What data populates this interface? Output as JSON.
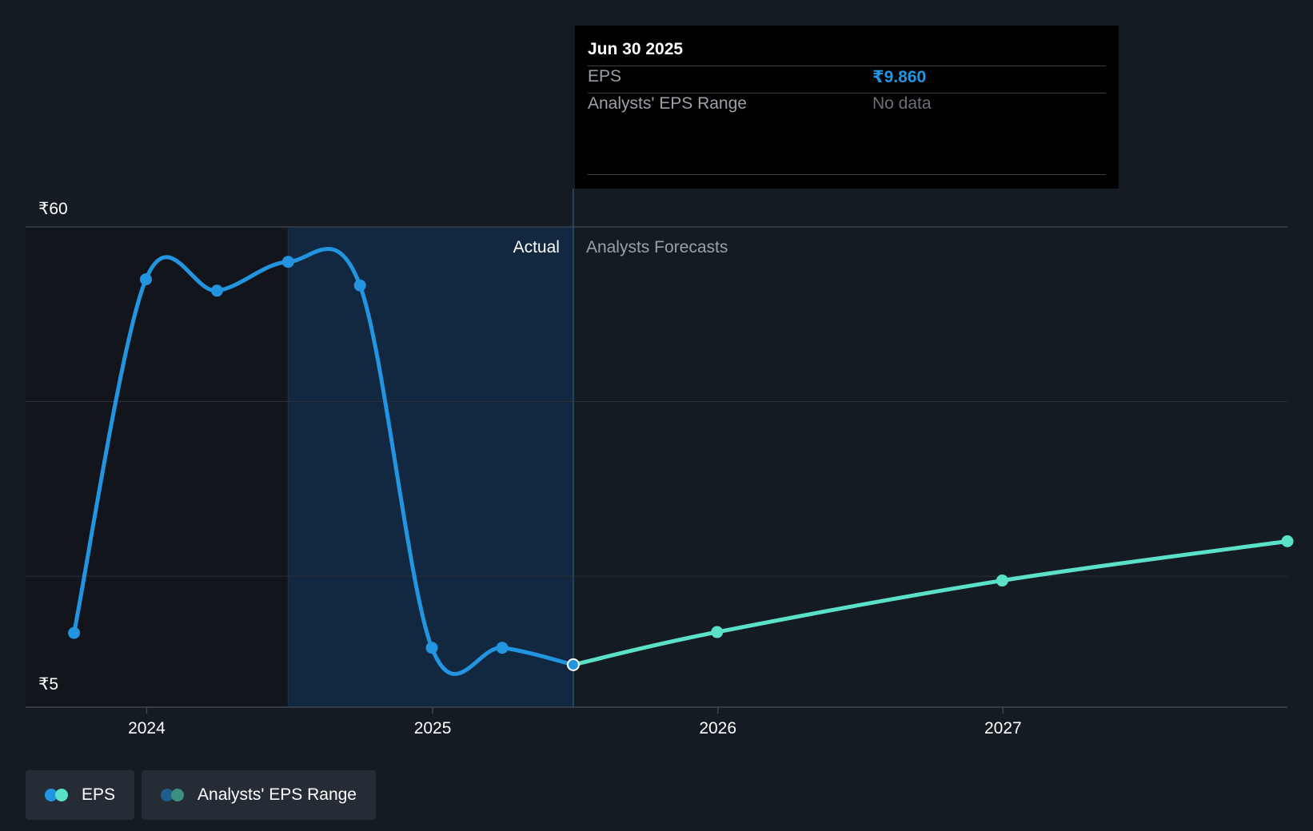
{
  "tooltip": {
    "date": "Jun 30 2025",
    "rows": [
      {
        "label": "EPS",
        "value": "₹9.860"
      },
      {
        "label": "Analysts' EPS Range",
        "value": "No data"
      }
    ]
  },
  "labels": {
    "actual": "Actual",
    "forecast": "Analysts Forecasts"
  },
  "legend": [
    {
      "label": "EPS",
      "colors": [
        "#2394df",
        "#5ce1c9"
      ]
    },
    {
      "label": "Analysts' EPS Range",
      "colors": [
        "#1f5d8a",
        "#3d8f84"
      ]
    }
  ],
  "colors": {
    "actual_line": "#2394df",
    "forecast_line": "#5ce1c9",
    "background": "#151b23",
    "grid": "#2f363f"
  },
  "chart_data": {
    "type": "line",
    "y_axis": {
      "min": 5,
      "max": 60,
      "ticks": [
        60,
        5
      ],
      "tick_labels": [
        "₹60",
        "₹5"
      ]
    },
    "x_axis": {
      "min": "2023-07-30",
      "max": "2027-12-31",
      "ticks": [
        "2024",
        "2025",
        "2026",
        "2027"
      ]
    },
    "divider_date": "2025-06-30",
    "series": [
      {
        "name": "EPS",
        "kind": "actual",
        "points": [
          {
            "x": "2023-09-30",
            "y": 13.5
          },
          {
            "x": "2023-12-31",
            "y": 54.0
          },
          {
            "x": "2024-03-31",
            "y": 52.7
          },
          {
            "x": "2024-06-30",
            "y": 56.0
          },
          {
            "x": "2024-09-30",
            "y": 53.3
          },
          {
            "x": "2024-12-31",
            "y": 11.8
          },
          {
            "x": "2025-03-31",
            "y": 11.8
          },
          {
            "x": "2025-06-30",
            "y": 9.86
          }
        ]
      },
      {
        "name": "EPS",
        "kind": "forecast",
        "points": [
          {
            "x": "2025-06-30",
            "y": 9.86
          },
          {
            "x": "2025-12-31",
            "y": 13.6
          },
          {
            "x": "2026-12-31",
            "y": 19.5
          },
          {
            "x": "2027-12-31",
            "y": 24.0
          }
        ]
      }
    ]
  }
}
